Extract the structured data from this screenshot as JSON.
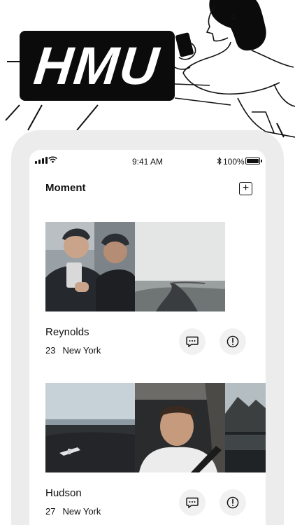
{
  "hero": {
    "badge_text": "HMU"
  },
  "status_bar": {
    "time": "9:41 AM",
    "bluetooth": "∗",
    "battery": "100%"
  },
  "nav": {
    "title": "Moment",
    "add_icon": "plus-square-icon"
  },
  "cards": [
    {
      "name": "Reynolds",
      "age": "23",
      "location": "New York",
      "photos": [
        "two-men-selfie-elevator",
        "foggy-winding-road"
      ],
      "message_icon": "chat-bubble-icon",
      "report_icon": "alert-circle-icon"
    },
    {
      "name": "Hudson",
      "age": "27",
      "location": "New York",
      "photos": [
        "plane-wreck-black-beach",
        "man-car-selfie",
        "mountain-lake"
      ],
      "message_icon": "chat-bubble-icon",
      "report_icon": "alert-circle-icon"
    }
  ]
}
